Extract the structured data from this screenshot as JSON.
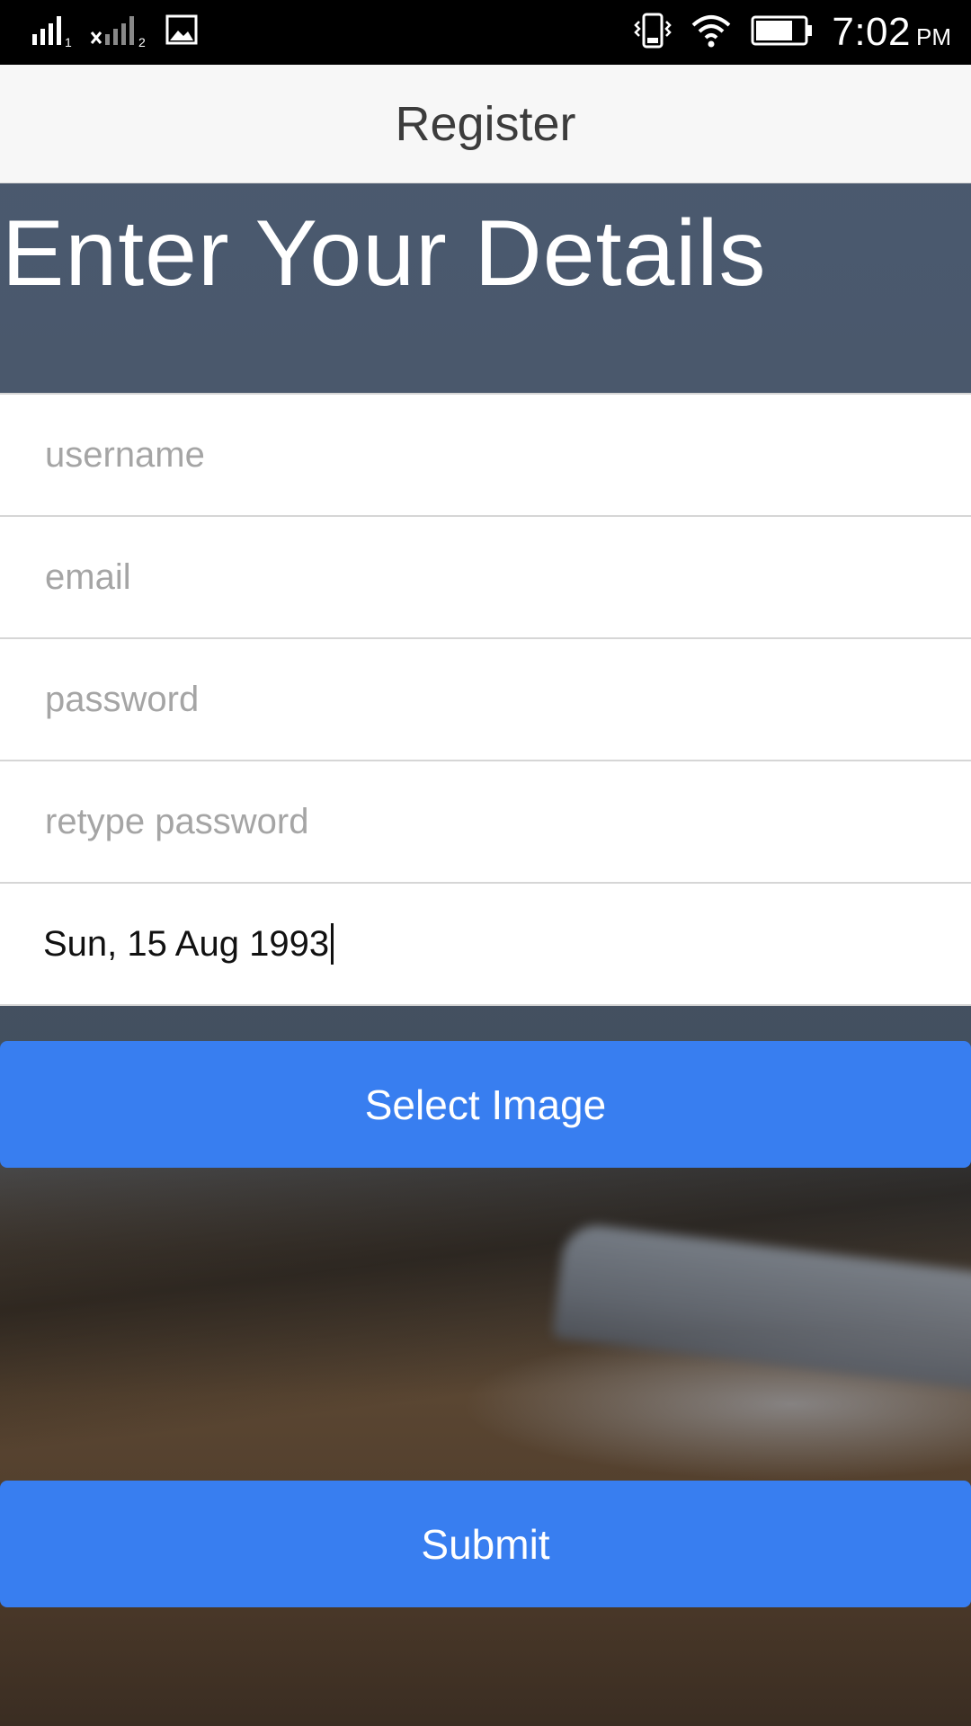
{
  "status_bar": {
    "time": "7:02",
    "ampm": "PM",
    "icons": [
      "signal-sim1-icon",
      "signal-sim2-icon",
      "gallery-notification-icon",
      "vibrate-icon",
      "wifi-icon",
      "battery-icon"
    ]
  },
  "app_bar": {
    "title": "Register"
  },
  "heading": {
    "text": "Enter Your Details"
  },
  "form": {
    "username": {
      "placeholder": "username",
      "value": ""
    },
    "email": {
      "placeholder": "email",
      "value": ""
    },
    "password": {
      "placeholder": "password",
      "value": ""
    },
    "retype_password": {
      "placeholder": "retype password",
      "value": ""
    },
    "birthdate": {
      "value": "Sun, 15 Aug 1993"
    }
  },
  "buttons": {
    "select_image": "Select Image",
    "submit": "Submit"
  },
  "colors": {
    "accent": "#387ef0",
    "status_bar": "#000000",
    "app_bar": "#f7f7f7"
  }
}
